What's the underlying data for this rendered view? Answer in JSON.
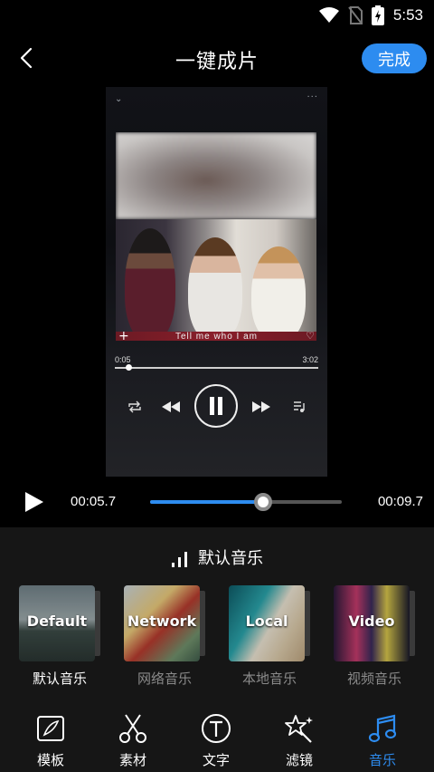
{
  "status_bar": {
    "time": "5:53"
  },
  "header": {
    "title": "一键成片",
    "done_label": "完成"
  },
  "preview": {
    "song_title": "Tell me who I am",
    "time_start": "0:05",
    "time_end": "3:02"
  },
  "playback": {
    "current": "00:05.7",
    "total": "00:09.7",
    "progress": 0.59
  },
  "music_panel": {
    "title": "默认音乐",
    "sources": [
      {
        "thumb_label": "Default",
        "name": "默认音乐",
        "active": true
      },
      {
        "thumb_label": "Network",
        "name": "网络音乐",
        "active": false
      },
      {
        "thumb_label": "Local",
        "name": "本地音乐",
        "active": false
      },
      {
        "thumb_label": "Video",
        "name": "视频音乐",
        "active": false
      }
    ]
  },
  "tabs": [
    {
      "label": "模板",
      "icon": "template-icon"
    },
    {
      "label": "素材",
      "icon": "scissors-icon"
    },
    {
      "label": "文字",
      "icon": "text-icon"
    },
    {
      "label": "滤镜",
      "icon": "magic-wand-icon"
    },
    {
      "label": "音乐",
      "icon": "music-note-icon",
      "active": true
    }
  ],
  "colors": {
    "accent": "#2d8cf0",
    "background": "#000000",
    "panel": "#161616",
    "inactive_text": "#8a8a8a"
  }
}
